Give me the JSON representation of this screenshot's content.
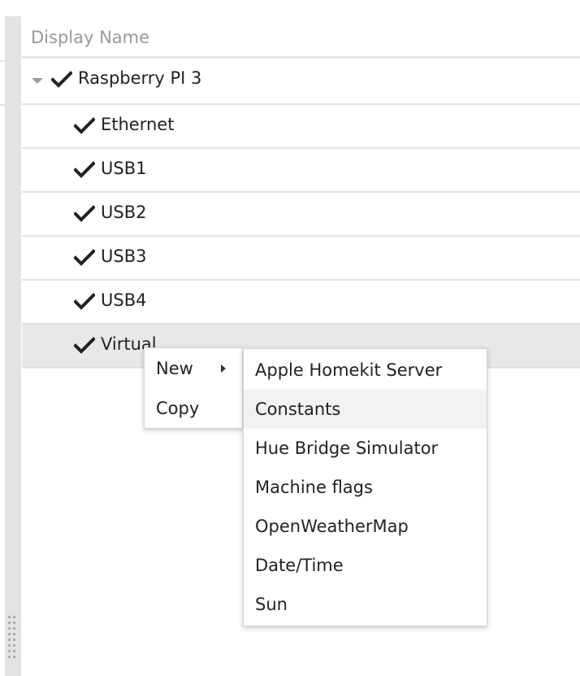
{
  "tree": {
    "header": "Display Name",
    "rows": [
      {
        "label": "Raspberry PI 3",
        "level": 0,
        "expanded": true,
        "checked": true
      },
      {
        "label": "Ethernet",
        "level": 1,
        "checked": true
      },
      {
        "label": "USB1",
        "level": 1,
        "checked": true
      },
      {
        "label": "USB2",
        "level": 1,
        "checked": true
      },
      {
        "label": "USB3",
        "level": 1,
        "checked": true
      },
      {
        "label": "USB4",
        "level": 1,
        "checked": true
      },
      {
        "label": "Virtual",
        "level": 1,
        "checked": true,
        "selected": true
      }
    ]
  },
  "context_menu": {
    "items": [
      {
        "label": "New",
        "has_submenu": true
      },
      {
        "label": "Copy"
      }
    ]
  },
  "submenu": {
    "items": [
      {
        "label": "Apple Homekit Server"
      },
      {
        "label": "Constants",
        "highlighted": true
      },
      {
        "label": "Hue Bridge Simulator"
      },
      {
        "label": "Machine flags"
      },
      {
        "label": "OpenWeatherMap"
      },
      {
        "label": "Date/Time"
      },
      {
        "label": "Sun"
      }
    ]
  },
  "colors": {
    "selected_row": "#e8e8e8",
    "menu_highlight": "#f2f2f2",
    "check": "#222222",
    "header_text": "#9a9a9a"
  }
}
